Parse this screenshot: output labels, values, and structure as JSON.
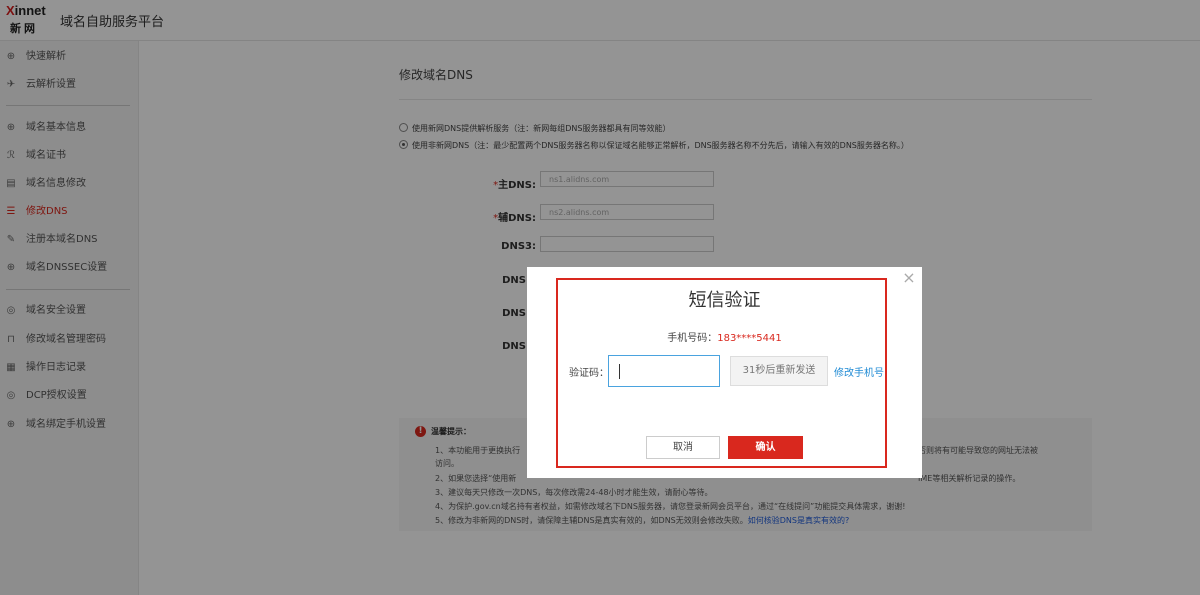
{
  "header": {
    "logo_top_x": "X",
    "logo_top_rest": "innet",
    "logo_bottom": "新网",
    "title": "域名自助服务平台"
  },
  "sidebar": {
    "items": [
      {
        "label": "快速解析",
        "icon": "globe-icon",
        "glyph": "⊕"
      },
      {
        "label": "云解析设置",
        "icon": "send-icon",
        "glyph": "✈"
      },
      {
        "label": "域名基本信息",
        "icon": "globe-icon",
        "glyph": "⊕"
      },
      {
        "label": "域名证书",
        "icon": "certificate-icon",
        "glyph": "ℛ"
      },
      {
        "label": "域名信息修改",
        "icon": "form-icon",
        "glyph": "▤"
      },
      {
        "label": "修改DNS",
        "icon": "server-icon",
        "glyph": "☰"
      },
      {
        "label": "注册本域名DNS",
        "icon": "edit-icon",
        "glyph": "✎"
      },
      {
        "label": "域名DNSSEC设置",
        "icon": "globe-icon",
        "glyph": "⊕"
      },
      {
        "label": "域名安全设置",
        "icon": "shield-icon",
        "glyph": "◎"
      },
      {
        "label": "修改域名管理密码",
        "icon": "lock-icon",
        "glyph": "⊓"
      },
      {
        "label": "操作日志记录",
        "icon": "log-icon",
        "glyph": "▦"
      },
      {
        "label": "DCP授权设置",
        "icon": "shield-icon",
        "glyph": "◎"
      },
      {
        "label": "域名绑定手机设置",
        "icon": "globe-icon",
        "glyph": "⊕"
      }
    ],
    "active_index": 5
  },
  "main": {
    "panel_title": "修改域名DNS",
    "radio_option_1": "使用新网DNS提供解析服务（注：新网每组DNS服务器都具有同等效能）",
    "radio_option_2": "使用非新网DNS（注：最少配置两个DNS服务器名称以保证域名能够正常解析，DNS服务器名称不分先后，请输入有效的DNS服务器名称。）",
    "dns_fields": [
      {
        "required": "*",
        "label": "主DNS:",
        "value": "ns1.alidns.com"
      },
      {
        "required": "*",
        "label": "辅DNS:",
        "value": "ns2.alidns.com"
      },
      {
        "required": "",
        "label": "DNS3:",
        "value": ""
      },
      {
        "required": "",
        "label": "DNS",
        "value": ""
      },
      {
        "required": "",
        "label": "DNS",
        "value": ""
      },
      {
        "required": "",
        "label": "DNS",
        "value": ""
      }
    ],
    "tips_icon": "!",
    "tips_title": "温馨提示：",
    "tips": {
      "t1a": "1、本功能用于更换执行",
      "t1b": "访问。",
      "t1_right": "否则将有可能导致您的网址无法被",
      "t2a": "2、如果您选择“使用新",
      "t2_right": "IME等相关解析记录的操作。",
      "t3": "3、建议每天只修改一次DNS，每次修改需24-48小时才能生效，请耐心等待。",
      "t4": "4、为保护.gov.cn域名持有者权益，如需修改域名下DNS服务器，请您登录新网会员平台，通过“在线提问”功能提交具体需求，谢谢!",
      "t5": "5、修改为非新网的DNS时，请保障主辅DNS是真实有效的，如DNS无效则会修改失败。",
      "t5_link": "如何核验DNS是真实有效的?"
    }
  },
  "dialog": {
    "close_glyph": "×",
    "title": "短信验证",
    "phone_label": "手机号码：",
    "phone_number": "183****5441",
    "code_label": "验证码：",
    "code_value": "",
    "resend_label": "31秒后重新发送",
    "change_phone_label": "修改手机号",
    "cancel_label": "取消",
    "confirm_label": "确认"
  }
}
